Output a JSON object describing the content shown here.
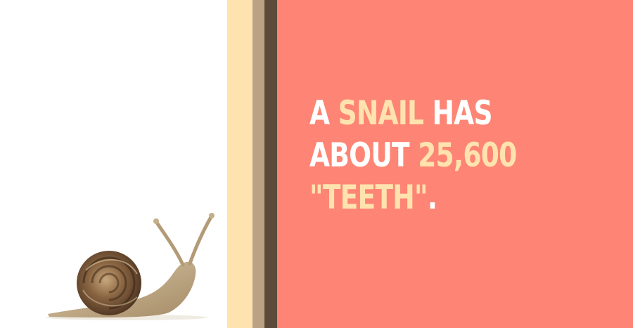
{
  "colors": {
    "background_left": "#ffffff",
    "stripe_light": "#ffe3ae",
    "stripe_tan": "#bba285",
    "stripe_dark": "#5c4b3a",
    "panel_coral": "#fe8575",
    "text_white": "#ffffff",
    "text_highlight": "#ffe3ae"
  },
  "fact": {
    "line1": {
      "part1": "A ",
      "highlight": "SNAIL",
      "part2": " HAS"
    },
    "line2": {
      "part1": "ABOUT ",
      "highlight": "25,600"
    },
    "line3": {
      "highlight": "\"TEETH\"",
      "part2": "."
    }
  },
  "image": {
    "subject": "snail-illustration"
  }
}
